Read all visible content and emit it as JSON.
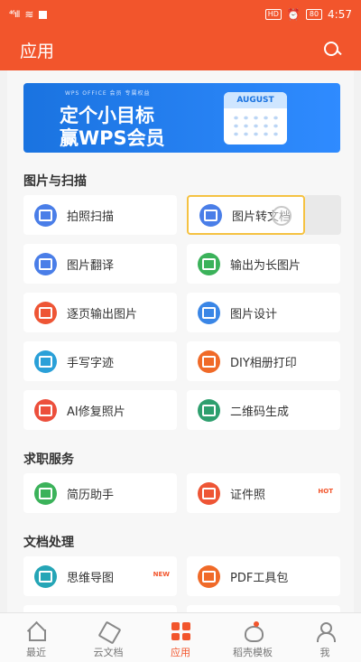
{
  "status_bar": {
    "signal": "⁴⁶ıll",
    "hd": "HD",
    "battery": "80",
    "time": "4:57"
  },
  "app_bar": {
    "title": "应用"
  },
  "banner": {
    "tag": "WPS OFFICE 会员 专属权益",
    "line1": "定个小目标",
    "line2": "赢WPS会员",
    "month": "AUGUST"
  },
  "sections": [
    {
      "title": "图片与扫描",
      "items": [
        {
          "label": "拍照扫描",
          "icon": "scan-icon",
          "color": "#4a7ee8"
        },
        {
          "label": "图片转文档",
          "icon": "image-to-doc-icon",
          "color": "#4a7ee8"
        },
        {
          "label": "图片翻译",
          "icon": "translate-icon",
          "color": "#4a7ee8"
        },
        {
          "label": "输出为长图片",
          "icon": "long-image-icon",
          "color": "#3bb25a"
        },
        {
          "label": "逐页输出图片",
          "icon": "page-image-icon",
          "color": "#ee5535"
        },
        {
          "label": "图片设计",
          "icon": "image-design-icon",
          "color": "#3a86e6"
        },
        {
          "label": "手写字迹",
          "icon": "handwriting-icon",
          "color": "#2aa0d8"
        },
        {
          "label": "DIY相册打印",
          "icon": "print-icon",
          "color": "#f06a28"
        },
        {
          "label": "AI修复照片",
          "icon": "photo-repair-icon",
          "color": "#ec4f3c"
        },
        {
          "label": "二维码生成",
          "icon": "qrcode-icon",
          "color": "#2e9f6e"
        }
      ]
    },
    {
      "title": "求职服务",
      "items": [
        {
          "label": "简历助手",
          "icon": "resume-icon",
          "color": "#3bb25a"
        },
        {
          "label": "证件照",
          "icon": "id-photo-icon",
          "color": "#ee5535",
          "badge": "HOT"
        }
      ]
    },
    {
      "title": "文档处理",
      "items": [
        {
          "label": "思维导图",
          "icon": "mindmap-icon",
          "color": "#25a5b6",
          "badge": "NEW"
        },
        {
          "label": "PDF工具包",
          "icon": "pdf-icon",
          "color": "#f06a28"
        }
      ]
    }
  ],
  "tabs": [
    {
      "label": "最近",
      "icon": "home-icon"
    },
    {
      "label": "云文档",
      "icon": "cloud-doc-icon"
    },
    {
      "label": "应用",
      "icon": "apps-icon",
      "active": true
    },
    {
      "label": "稻壳模板",
      "icon": "template-icon"
    },
    {
      "label": "我",
      "icon": "profile-icon"
    }
  ],
  "colors": {
    "accent": "#f2552c",
    "highlight_border": "#f5c242"
  }
}
